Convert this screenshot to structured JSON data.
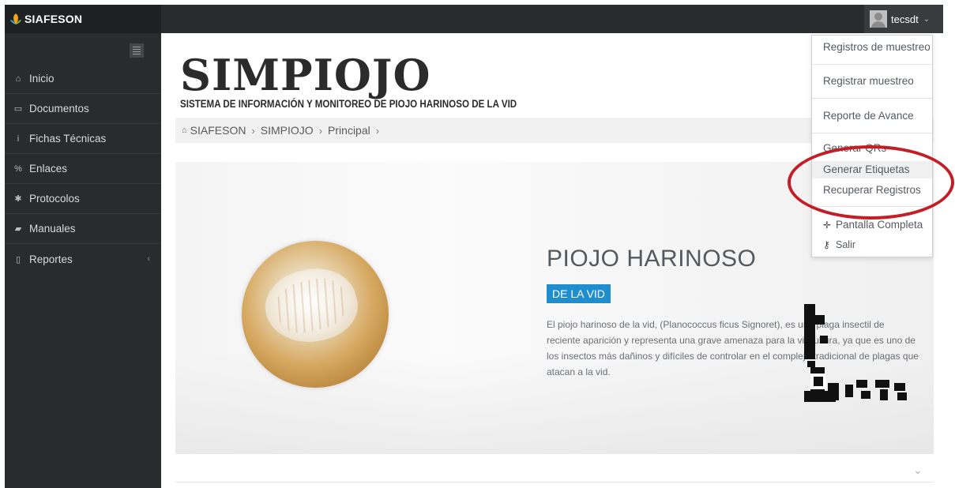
{
  "brand": {
    "name": "SIAFESON",
    "logo_icon": "leaf-logo-icon"
  },
  "user": {
    "name": "tecsdt",
    "avatar_icon": "user-avatar-icon",
    "caret_icon": "chevron-down-icon"
  },
  "sidebar": {
    "toggle_icon": "hamburger-icon",
    "items": [
      {
        "label": "Inicio",
        "icon": "home-icon",
        "glyph": "⌂"
      },
      {
        "label": "Documentos",
        "icon": "folder-icon",
        "glyph": "▭"
      },
      {
        "label": "Fichas Técnicas",
        "icon": "info-icon",
        "glyph": "i"
      },
      {
        "label": "Enlaces",
        "icon": "link-icon",
        "glyph": "%"
      },
      {
        "label": "Protocolos",
        "icon": "gear-icon",
        "glyph": "✱"
      },
      {
        "label": "Manuales",
        "icon": "book-icon",
        "glyph": "▰"
      },
      {
        "label": "Reportes",
        "icon": "file-icon",
        "glyph": "▯",
        "arrow": "‹"
      }
    ]
  },
  "header": {
    "title": "SIMPIOJO",
    "subtitle": "SISTEMA DE INFORMACIÓN Y MONITOREO DE PIOJO HARINOSO DE LA VID"
  },
  "breadcrumb": {
    "home_icon": "home-icon",
    "items": [
      "SIAFESON",
      "SIMPIOJO",
      "Principal"
    ],
    "separator": "›"
  },
  "hero": {
    "title": "PIOJO HARINOSO",
    "badge": "DE LA VID",
    "description": "El piojo harinoso de la vid, (Planococcus ficus Signoret), es una plaga insectil de reciente aparición y representa una grave amenaza para la viticultura, ya que es uno de los insectos más dañinos y difíciles de controlar en el complejo tradicional de plagas que atacan a la vid."
  },
  "dropdown": {
    "items": [
      {
        "label": "Registros de muestreo"
      },
      {
        "label": "Registrar muestreo"
      },
      {
        "label": "Reporte de Avance"
      },
      {
        "label": "Generar QRs"
      },
      {
        "label": "Generar Etiquetas",
        "highlighted": true
      },
      {
        "label": "Recuperar Registros"
      },
      {
        "label": "Pantalla Completa",
        "icon": "move-icon",
        "glyph": "✛"
      },
      {
        "label": "Salir",
        "icon": "key-icon",
        "glyph": "⚷"
      }
    ]
  },
  "colors": {
    "topbar": "#2a2b2d",
    "sidebar": "#2a2b2d",
    "badge": "#1f8dce",
    "annotation_circle": "#c31d25"
  }
}
